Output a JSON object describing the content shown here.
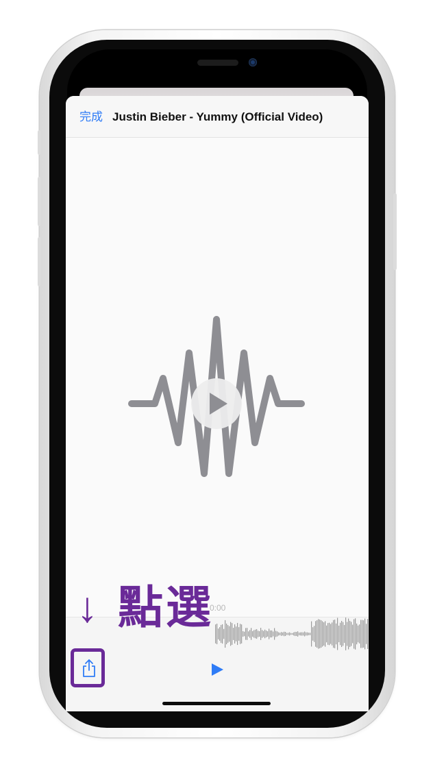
{
  "header": {
    "done_label": "完成",
    "title": "Justin Bieber - Yummy (Official Video)"
  },
  "player": {
    "time": "0:00",
    "play_icon": "play-icon",
    "share_icon": "share-icon"
  },
  "annotation": {
    "arrow": "↓",
    "text": "點選"
  },
  "colors": {
    "accent": "#2f7cf6",
    "annotation": "#6a2a98",
    "waveform": "#8e8e93"
  }
}
